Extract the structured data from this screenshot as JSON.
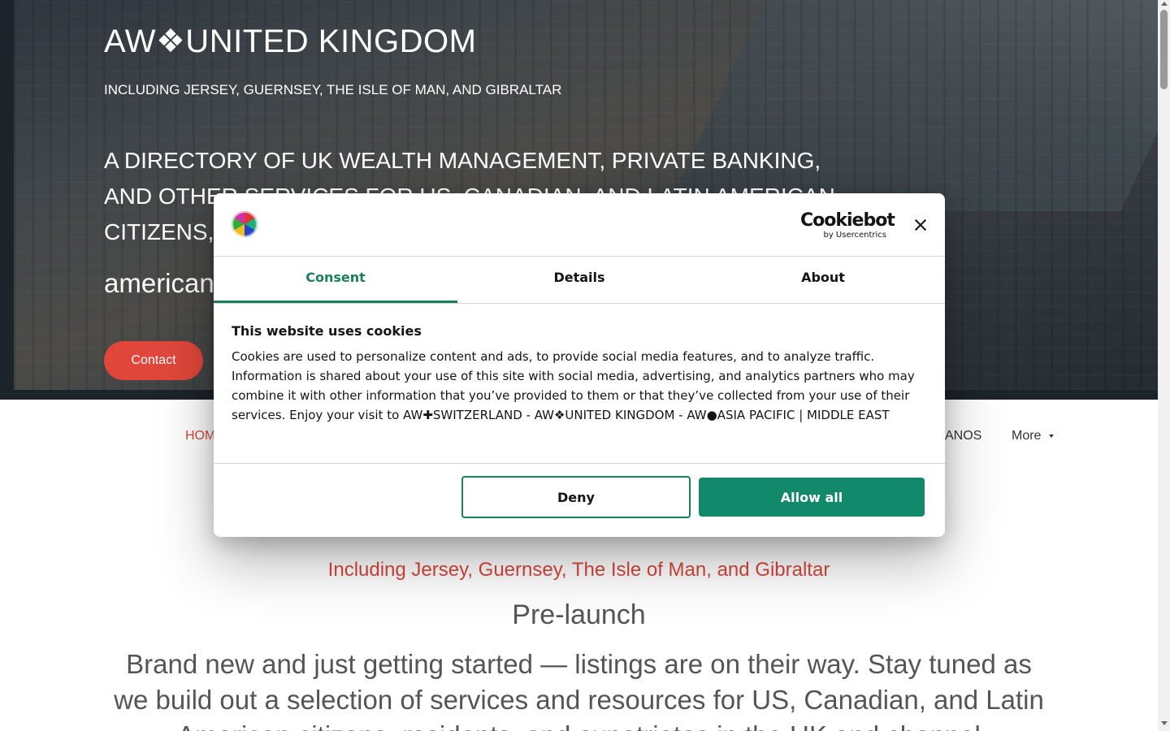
{
  "hero": {
    "title": "AW❖UNITED KINGDOM",
    "subtitle": "INCLUDING JERSEY, GUERNSEY, THE ISLE OF MAN, AND GIBRALTAR",
    "description": "A DIRECTORY OF UK WEALTH MANAGEMENT, PRIVATE BANKING, AND OTHER SERVICES FOR US, CANADIAN, AND LATIN AMERICAN CITIZENS,",
    "partial_text": "american",
    "contact_label": "Contact"
  },
  "nav": {
    "home_partial": "HOM",
    "anos_partial": "ANOS",
    "more_label": "More"
  },
  "main": {
    "including": "Including Jersey, Guernsey, The Isle of Man, and Gibraltar",
    "prelaunch": "Pre-launch",
    "body": "Brand new and just getting started — listings are on their way. Stay tuned as we build out a selection of services and resources for US, Canadian, and Latin American citizens, residents, and expatriates in the UK and channel"
  },
  "cookie_dialog": {
    "brand_main": "Cookiebot",
    "brand_sub": "by Usercentrics",
    "tabs": [
      "Consent",
      "Details",
      "About"
    ],
    "active_tab": "Consent",
    "heading": "This website uses cookies",
    "text": "Cookies are used to personalize content and ads, to provide social media features, and to analyze traffic. Information is shared about your use of this site with social media, advertising, and analytics partners who may combine it with other information that you’ve provided to them or that they’ve collected from your use of their services. Enjoy your visit to AW✚SWITZERLAND - AW❖UNITED KINGDOM - AW●ASIA PACIFIC | MIDDLE EAST",
    "deny_label": "Deny",
    "allow_label": "Allow all",
    "accent_color": "#11896a"
  },
  "colors": {
    "brand_red": "#e0473a",
    "nav_active": "#d8473b"
  }
}
